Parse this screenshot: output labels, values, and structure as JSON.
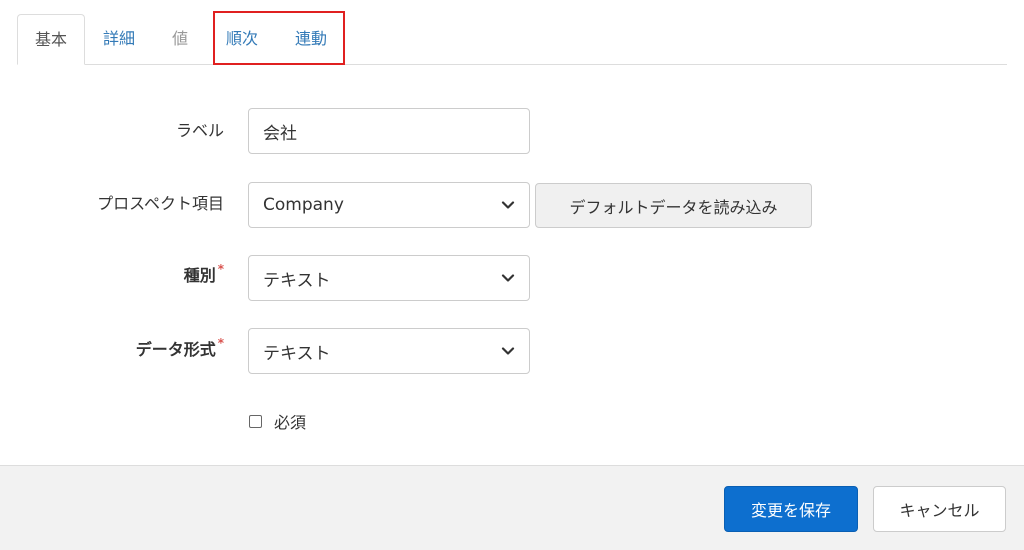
{
  "tabs": [
    {
      "label": "基本",
      "state": "active"
    },
    {
      "label": "詳細",
      "state": "link"
    },
    {
      "label": "値",
      "state": "disabled"
    },
    {
      "label": "順次",
      "state": "link"
    },
    {
      "label": "連動",
      "state": "link"
    }
  ],
  "form": {
    "label": {
      "title": "ラベル",
      "value": "会社"
    },
    "prospect_field": {
      "title": "プロスペクト項目",
      "value": "Company",
      "load_default_label": "デフォルトデータを読み込み"
    },
    "type": {
      "title": "種別",
      "required_mark": "*",
      "value": "テキスト"
    },
    "data_format": {
      "title": "データ形式",
      "required_mark": "*",
      "value": "テキスト"
    },
    "required_checkbox": {
      "label": "必須",
      "checked": false
    }
  },
  "footer": {
    "save_label": "変更を保存",
    "cancel_label": "キャンセル"
  },
  "colors": {
    "link": "#337ab7",
    "primary": "#0d6fcf",
    "required": "#d9534f",
    "highlight": "#e02020"
  },
  "icons": {
    "select_arrow": "chevron-down-icon"
  }
}
